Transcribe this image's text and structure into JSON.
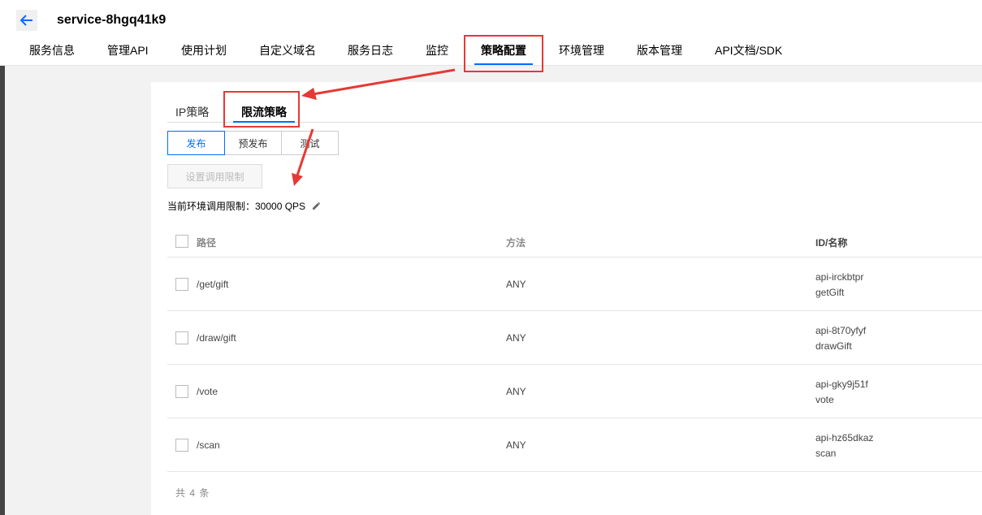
{
  "header": {
    "service_name": "service-8hgq41k9",
    "tabs": [
      {
        "label": "服务信息"
      },
      {
        "label": "管理API"
      },
      {
        "label": "使用计划"
      },
      {
        "label": "自定义域名"
      },
      {
        "label": "服务日志"
      },
      {
        "label": "监控"
      },
      {
        "label": "策略配置"
      },
      {
        "label": "环境管理"
      },
      {
        "label": "版本管理"
      },
      {
        "label": "API文档/SDK"
      }
    ],
    "active_tab": "策略配置"
  },
  "policy": {
    "subtabs": [
      {
        "label": "IP策略"
      },
      {
        "label": "限流策略"
      }
    ],
    "active_subtab": "限流策略",
    "env_buttons": [
      {
        "label": "发布"
      },
      {
        "label": "预发布"
      },
      {
        "label": "测试"
      }
    ],
    "active_env": "发布",
    "set_limit_button": "设置调用限制",
    "current_limit_text": "当前环境调用限制：30000 QPS"
  },
  "table": {
    "columns": {
      "path": "路径",
      "method": "方法",
      "idname": "ID/名称"
    },
    "rows": [
      {
        "path": "/get/gift",
        "method": "ANY",
        "id": "api-irckbtpr",
        "name": "getGift"
      },
      {
        "path": "/draw/gift",
        "method": "ANY",
        "id": "api-8t70yfyf",
        "name": "drawGift"
      },
      {
        "path": "/vote",
        "method": "ANY",
        "id": "api-gky9j51f",
        "name": "vote"
      },
      {
        "path": "/scan",
        "method": "ANY",
        "id": "api-hz65dkaz",
        "name": "scan"
      }
    ],
    "total_text": "共 4 条"
  },
  "colors": {
    "accent": "#006eff",
    "annotation_red": "#e53935"
  },
  "icons": {
    "back": "arrow-left-icon",
    "edit": "pencil-icon"
  }
}
